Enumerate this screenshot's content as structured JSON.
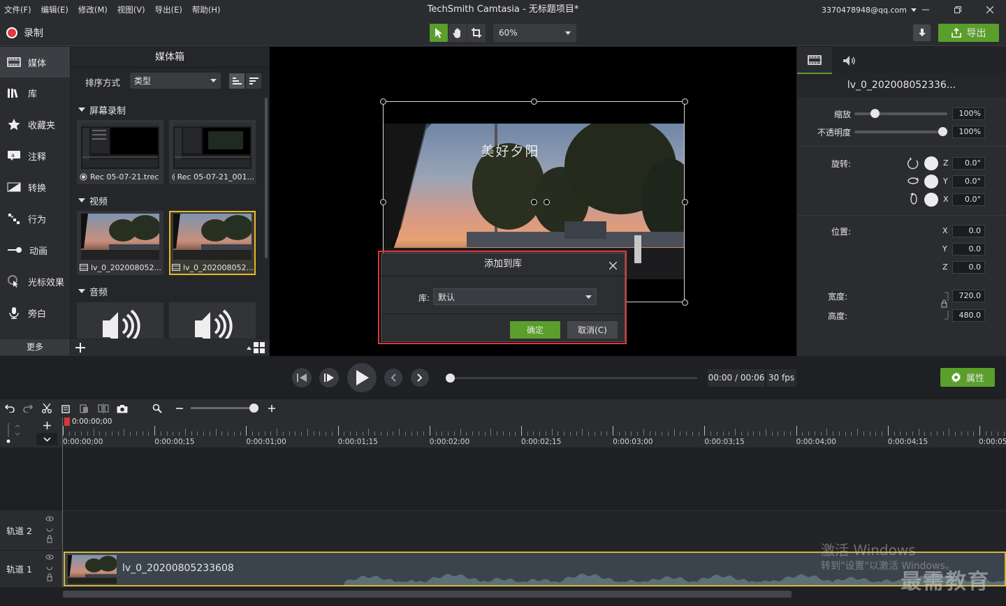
{
  "menu": [
    "文件(F)",
    "编辑(E)",
    "修改(M)",
    "视图(V)",
    "导出(E)",
    "帮助(H)"
  ],
  "app_title": "TechSmith Camtasia - 无标题项目*",
  "account": "3370478948@qq.com",
  "toolbar": {
    "record_label": "录制",
    "zoom_value": "60%",
    "export_label": "导出"
  },
  "nav": [
    {
      "label": "媒体",
      "icon": "film-icon"
    },
    {
      "label": "库",
      "icon": "library-icon"
    },
    {
      "label": "收藏夹",
      "icon": "star-icon"
    },
    {
      "label": "注释",
      "icon": "annotation-icon"
    },
    {
      "label": "转换",
      "icon": "transition-icon"
    },
    {
      "label": "行为",
      "icon": "behavior-icon"
    },
    {
      "label": "动画",
      "icon": "animation-icon"
    },
    {
      "label": "光标效果",
      "icon": "cursor-icon"
    },
    {
      "label": "旁白",
      "icon": "microphone-icon"
    }
  ],
  "nav_more": "更多",
  "bin": {
    "title": "媒体箱",
    "sort_label": "排序方式",
    "sort_value": "类型",
    "groups": {
      "screen": "屏幕录制",
      "video": "视频",
      "audio": "音频"
    },
    "screen_items": [
      "Rec 05-07-21.trec",
      "Rec 05-07-21_001..."
    ],
    "video_items": [
      "lv_0_202008052...",
      "lv_0_202008052..."
    ]
  },
  "canvas": {
    "overlay_text": "美好夕阳"
  },
  "dialog": {
    "title": "添加到库",
    "library_label": "库:",
    "library_value": "默认",
    "ok_label": "确定",
    "cancel_label": "取消(C)"
  },
  "properties": {
    "clip_name": "lv_0_202008052336...",
    "scale_label": "缩放",
    "scale_value": "100%",
    "opacity_label": "不透明度",
    "opacity_value": "100%",
    "rotation_label": "旋转:",
    "rot_z": "0.0°",
    "rot_y": "0.0°",
    "rot_x": "0.0°",
    "position_label": "位置:",
    "pos_x": "0.0",
    "pos_y": "0.0",
    "pos_z": "0.0",
    "width_label": "宽度:",
    "width_value": "720.0",
    "height_label": "高度:",
    "height_value": "480.0",
    "axis_z": "Z",
    "axis_y": "Y",
    "axis_x": "X"
  },
  "playback": {
    "timecode": "00:00 / 00:06",
    "fps": "30 fps",
    "props_button": "属性"
  },
  "timeline": {
    "playhead": "0:00:00;00",
    "ticks": [
      "0:00:00;00",
      "0:00:00;15",
      "0:00:01;00",
      "0:00:01;15",
      "0:00:02;00",
      "0:00:02;15",
      "0:00:03;00",
      "0:00:03;15",
      "0:00:04;00",
      "0:00:04;15",
      "0:00:05"
    ],
    "track2": "轨道 2",
    "track1": "轨道 1",
    "clip_name": "lv_0_20200805233608"
  },
  "watermark": {
    "line1": "激活 Windows",
    "line2": "转到\"设置\"以激活 Windows。",
    "brand": "最需教育"
  },
  "colors": {
    "accent_green": "#5a9e2b",
    "selection_yellow": "#e8b92a",
    "highlight_red": "#e0393e",
    "record_red": "#e0393e"
  }
}
